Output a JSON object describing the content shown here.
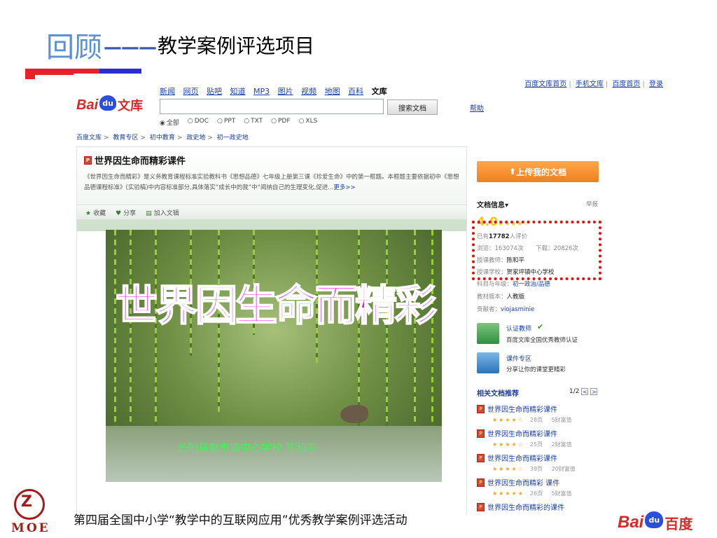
{
  "slide": {
    "title_main": "回顾",
    "title_dash": "———",
    "title_sub": "教学案例评选项目",
    "footer_text": "第四届全国中小学“教学中的互联网应用”优秀教学案例评选活动",
    "moe_logo_text": "MOE",
    "colors": {
      "title_blue": "#5b8fd6",
      "bar_red": "#e8202a",
      "bar_blue": "#2b2bd9",
      "dash_red": "#e01010",
      "accent_orange": "#f08020"
    }
  },
  "wenku": {
    "top_links": [
      "百度文库首页",
      "手机文库",
      "百度首页",
      "登录"
    ],
    "logo": {
      "bai": "Bai",
      "du": "du",
      "wenku": "文库"
    },
    "nav": [
      "新闻",
      "网页",
      "贴吧",
      "知道",
      "MP3",
      "图片",
      "视频",
      "地图",
      "百科",
      "文库"
    ],
    "search": {
      "value": "",
      "button": "搜索文档",
      "help": "帮助"
    },
    "filters": [
      "全部",
      "DOC",
      "PPT",
      "TXT",
      "PDF",
      "XLS"
    ],
    "breadcrumb": [
      "百度文库",
      "教育专区",
      "初中教育",
      "政史地",
      "初一政史地"
    ],
    "doc": {
      "title": "世界因生命而精彩课件",
      "description": "《世界因生命而精彩》是义务教育课程标准实验教科书《思想品德》七年级上册第三课《珍爱生命》中的第一框题。本框题主要依据初中《思想品德课程标准》(实验稿)中内容标准部分,具体落实“成长中的我”中“阅纳自己的生理变化,促进...",
      "more": "更多>>"
    },
    "actions": [
      "收藏",
      "分享",
      "加入文辑"
    ],
    "slide_preview": {
      "heading": "世界因生命而精彩",
      "footer": "长阳县磨市镇中心学校 陈和平"
    },
    "sidebar": {
      "upload_button": "上传我的文档",
      "doc_info_title": "文档信息",
      "report": "举报",
      "rating": "4.0",
      "rating_stars": "★★★★☆",
      "rating_count_prefix": "已有",
      "rating_count": "17782",
      "rating_count_suffix": "人评价",
      "views": "浏览：163074次",
      "downloads": "下载：20826次",
      "teacher_label": "授课教师：",
      "teacher": "陈和平",
      "school_label": "授课学校：",
      "school": "贺家坪镇中心学校",
      "subject_label": "科目与年级：",
      "subject": "初一政治/品德",
      "edition_label": "教材版本：",
      "edition": "人教版",
      "contributor_label": "贡献者：",
      "contributor": "viojasminie",
      "cert_title": "认证教师",
      "cert_desc": "百度文库全国优秀教师认证",
      "course_title": "课件专区",
      "course_desc": "分享让你的课堂更精彩",
      "related_title": "相关文档推荐",
      "pager": "1/2",
      "related": [
        {
          "title": "世界因生命而精彩课件",
          "stars": "★★★★☆",
          "pages": "28页",
          "cost": "5财富值"
        },
        {
          "title": "世界因生命而精彩课件",
          "stars": "★★★★☆",
          "pages": "25页",
          "cost": "2财富值"
        },
        {
          "title": "世界因生命而精彩课件",
          "stars": "★★★★☆",
          "pages": "39页",
          "cost": "20财富值"
        },
        {
          "title": "世界因生命而精彩 课件",
          "stars": "★★★★★",
          "pages": "26页",
          "cost": "5财富值"
        },
        {
          "title": "世界因生命而精彩的课件",
          "stars": "",
          "pages": "",
          "cost": ""
        }
      ]
    }
  },
  "baidu_logo": {
    "bai": "Bai",
    "du": "du",
    "baidu": "百度"
  }
}
